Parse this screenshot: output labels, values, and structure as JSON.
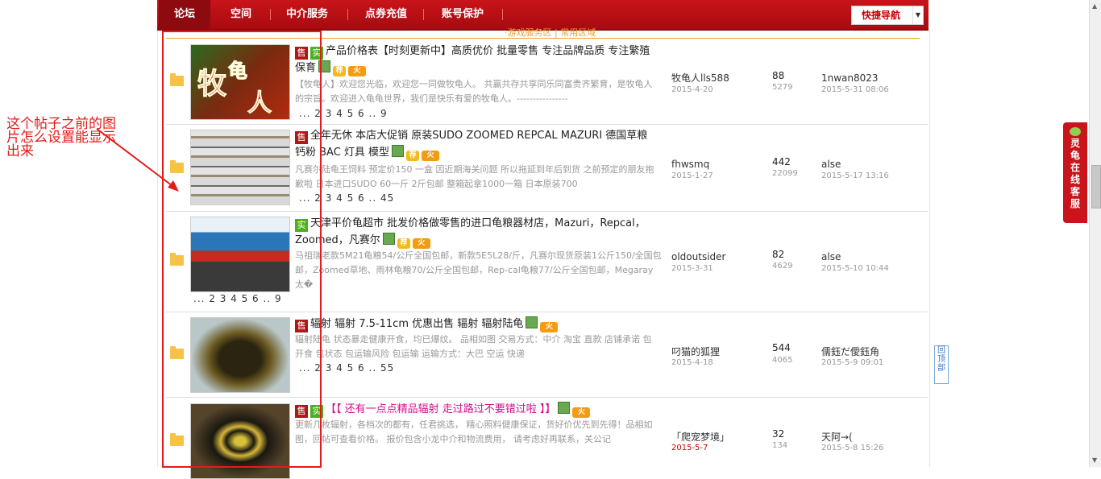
{
  "nav": {
    "tabs": [
      {
        "label": "论坛",
        "active": true
      },
      {
        "label": "空间"
      },
      {
        "label": "中介服务"
      },
      {
        "label": "点券充值"
      },
      {
        "label": "账号保护"
      }
    ],
    "quick_nav": "快捷导航"
  },
  "top_strip_text": "·游戏服务区 | 常用区域",
  "annotation": "这个帖子之前的图片怎么设置能显示出来",
  "side_service": "灵龟在线客服",
  "back_to_top": "回顶部",
  "threads": [
    {
      "tags": [
        "售",
        "实"
      ],
      "title": "产品价格表【时刻更新中】高质优价 批量零售 专注品牌品质 专注繁殖保育",
      "icons": [
        "image-icon",
        "recommend-icon",
        "hot-icon"
      ],
      "excerpt": "【牧龟人】欢迎您光临，欢迎您一同做牧龟人。 共赢共存共享同乐同富贵齐繁育，是牧龟人的宗旨。欢迎进入龟龟世界，我们是快乐有爱的牧龟人。----------------",
      "pages": "... 2 3 4 5 6 .. 9",
      "author": "牧龟人lls588",
      "author_date": "2015-4-20",
      "replies": "88",
      "views": "5279",
      "last_user": "1nwan8023",
      "last_time": "2015-5-31 08:06"
    },
    {
      "tags": [
        "售"
      ],
      "title": "全年无休 本店大促销 原装SUDO ZOOMED REPCAL MAZURI 德国草粮 钙粉 BAC 灯具 模型",
      "icons": [
        "image-icon",
        "recommend-icon",
        "hot-icon"
      ],
      "excerpt": "凡赛尔陆龟王饲料 预定价150 一盒 因近期海关问题 所以拖延到年后到货 之前预定的朋友抱歉啦 日本进口SUDO 60一斤 2斤包邮 整箱起拿1000一箱 日本原装700",
      "pages": "... 2 3 4 5 6 .. 45",
      "author": "fhwsmq",
      "author_date": "2015-1-27",
      "replies": "442",
      "views": "22099",
      "last_user": "alse",
      "last_time": "2015-5-17 13:16"
    },
    {
      "tags": [
        "实"
      ],
      "title": "天津平价龟超市 批发价格做零售的进口龟粮器材店，Mazuri，Repcal，Zoomed，凡赛尔",
      "icons": [
        "image-icon",
        "recommend-icon",
        "hot-icon"
      ],
      "excerpt": "马祖瑞老款5M21龟粮54/公斤全国包邮，新款5E5L28/斤，凡赛尔现货原装1公斤150/全国包邮，Zoomed草地、雨林龟粮70/公斤全国包邮，Rep-cal龟粮77/公斤全国包邮，Megaray太�",
      "pages": "... 2 3 4 5 6 .. 9",
      "author": "oldoutsider",
      "author_date": "2015-3-31",
      "replies": "82",
      "views": "4629",
      "last_user": "alse",
      "last_time": "2015-5-10 10:44"
    },
    {
      "tags": [
        "售"
      ],
      "title": "辐射 辐射 7.5-11cm 优惠出售 辐射 辐射陆龟",
      "icons": [
        "image-icon",
        "hot-icon"
      ],
      "excerpt": "辐射陆龟 状态暴走健康开食，均已爆纹。 品相如图 交易方式：中介 淘宝 直款 店铺承诺 包开食 包状态 包运输风险 包运输 运输方式：大巴 空运 快递",
      "pages": "... 2 3 4 5 6 .. 55",
      "author": "叼猫的狐狸",
      "author_date": "2015-4-18",
      "replies": "544",
      "views": "4065",
      "last_user": "儒鈺だ僾鈺角",
      "last_time": "2015-5-9 09:01"
    },
    {
      "tags": [
        "售",
        "实"
      ],
      "title": "【【 还有一点点精品辐射 走过路过不要错过啦 】】",
      "icons": [
        "image-icon",
        "hot-icon"
      ],
      "excerpt": "更新几枚辐射，各档次的都有，任君挑选， 精心照料健康保证，货好价优先到先得！品相如图，回帖可查看价格。 报价包含小龙中介和物流费用， 请考虑好再联系，关公记",
      "pages": "",
      "author": "「爬宠梦境」",
      "author_date": "2015-5-7",
      "replies": "32",
      "views": "134",
      "last_user": "天阿→(",
      "last_time": "2015-5-8 15:26"
    }
  ],
  "colors": {
    "nav_red": "#c8141a",
    "annotation_red": "#e51a1a",
    "title_pink": "#d40d8c"
  }
}
